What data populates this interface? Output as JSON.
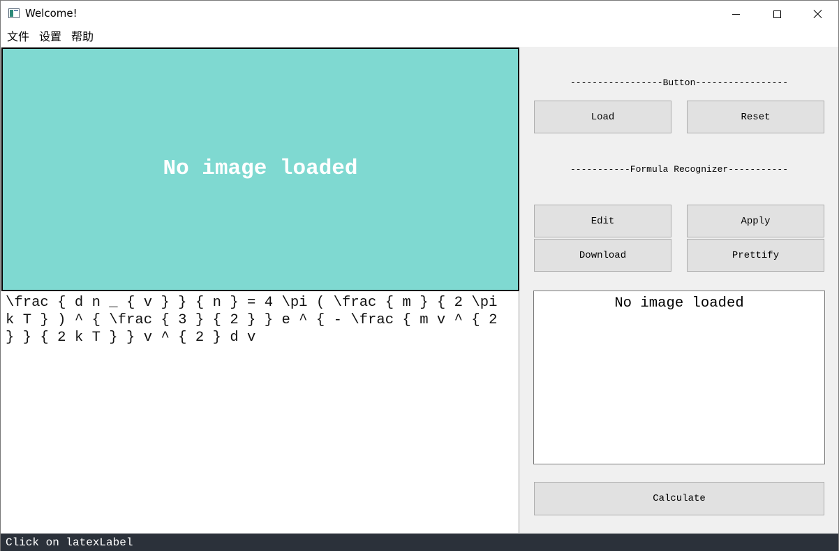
{
  "window": {
    "title": "Welcome!"
  },
  "menu": {
    "items": [
      "文件",
      "设置",
      "帮助"
    ]
  },
  "image_panel": {
    "placeholder": "No image loaded",
    "background": "#7fd9d1"
  },
  "latex": {
    "text": "\\frac { d n _ { v } } { n } = 4 \\pi ( \\frac { m } { 2 \\pi k T } ) ^ { \\frac { 3 } { 2 } } e ^ { - \\frac { m v ^ { 2 } } { 2 k T } } v ^ { 2 } d v"
  },
  "controls": {
    "button_section_label": "-----------------Button-----------------",
    "load_label": "Load",
    "reset_label": "Reset",
    "formula_section_label": "-----------Formula Recognizer-----------",
    "edit_label": "Edit",
    "apply_label": "Apply",
    "download_label": "Download",
    "prettify_label": "Prettify",
    "calculate_label": "Calculate"
  },
  "result": {
    "text": "No image loaded"
  },
  "status": {
    "text": "Click on latexLabel",
    "background": "#2b313a"
  }
}
